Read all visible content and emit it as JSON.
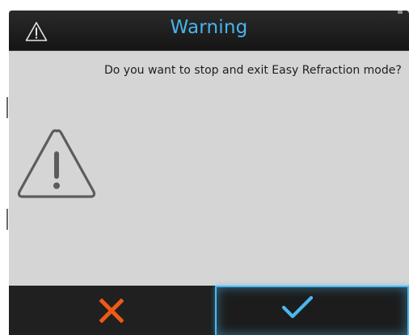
{
  "dialog": {
    "title": "Warning",
    "message": "Do you want to stop and exit Easy Refraction mode?",
    "title_icon": "warning-icon",
    "body_icon": "warning-icon"
  },
  "buttons": {
    "cancel": {
      "icon": "close-icon",
      "color": "#f05a14"
    },
    "confirm": {
      "icon": "checkmark-icon",
      "color": "#49b8ee"
    }
  },
  "colors": {
    "title_text": "#4ab3ea",
    "titlebar_bg": "#1a1a1a",
    "dialog_bg": "#d5d5d5",
    "footer_bg": "#1e1e1e"
  }
}
